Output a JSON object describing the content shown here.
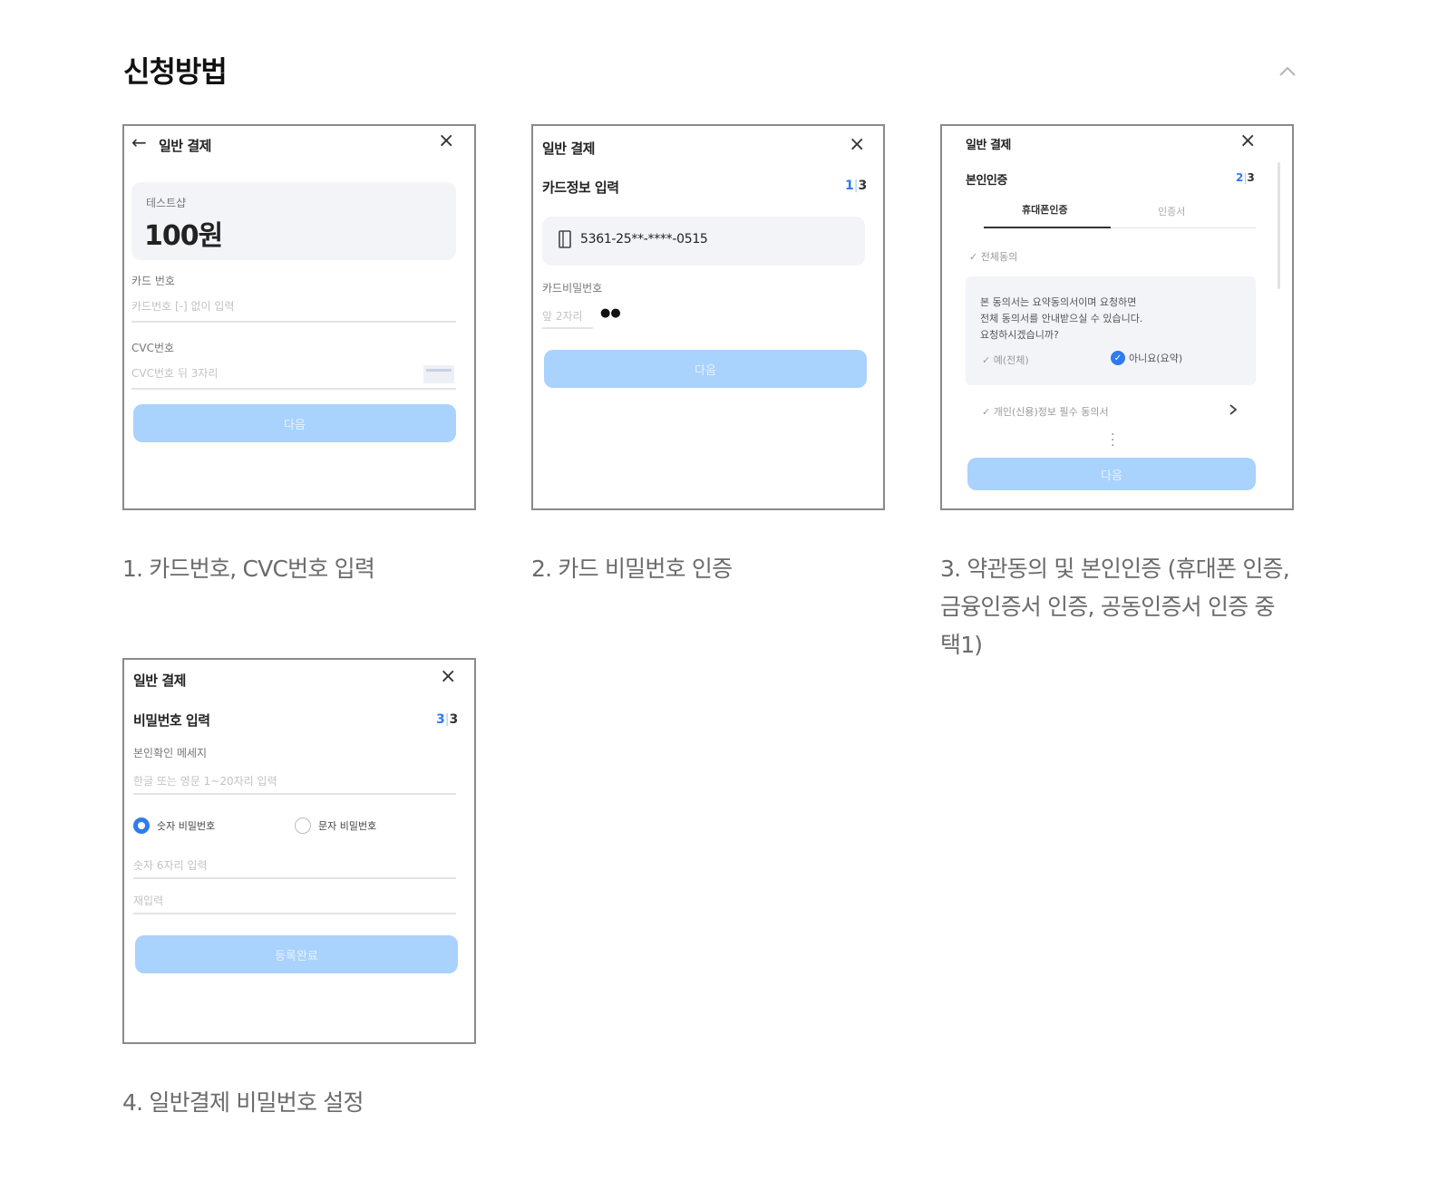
{
  "section": {
    "title": "신청방법",
    "collapse_icon": "chevron-up-icon"
  },
  "steps": [
    {
      "caption": "1. 카드번호, CVC번호 입력",
      "screen": {
        "back_icon": "←",
        "title": "일반 결제",
        "close_icon": "×",
        "shop_name": "테스트샵",
        "amount": "100원",
        "card_label": "카드 번호",
        "card_placeholder": "카드번호 [-] 없이 입력",
        "cvc_label": "CVC번호",
        "cvc_placeholder": "CVC번호 뒤 3자리",
        "next_button": "다음"
      }
    },
    {
      "caption": "2. 카드 비밀번호 인증",
      "screen": {
        "title": "일반 결제",
        "close_icon": "×",
        "subtitle": "카드정보 입력",
        "page_current": "1",
        "page_sep": "|",
        "page_total": "3",
        "card_number": "5361-25**-****-0515",
        "pw_label": "카드비밀번호",
        "pw_placeholder": "앞 2자리",
        "pw_dots": "●●",
        "next_button": "다음"
      }
    },
    {
      "caption": "3. 약관동의 및 본인인증 (휴대폰 인증, 금융인증서 인증, 공동인증서 인증 중 택1)",
      "screen": {
        "title": "일반 결제",
        "close_icon": "×",
        "subtitle": "본인인증",
        "page_current": "2",
        "page_sep": "|",
        "page_total": "3",
        "tab_phone": "휴대폰인증",
        "tab_cert": "인증서",
        "agree_all": "전체동의",
        "notice_line1": "본 동의서는 요약동의서이며 요청하면",
        "notice_line2": "전체 동의서를 안내받으실 수 있습니다.",
        "notice_line3": "요청하시겠습니까?",
        "opt_yes": "예(전체)",
        "opt_no": "아니요(요약)",
        "consent_item": "개인(신용)정보 필수 동의서",
        "next_button": "다음"
      }
    },
    {
      "caption": "4. 일반결제 비밀번호 설정",
      "screen": {
        "title": "일반 결제",
        "close_icon": "×",
        "subtitle": "비밀번호 입력",
        "page_current": "3",
        "page_sep": "|",
        "page_total": "3",
        "msg_label": "본인확인 메세지",
        "msg_placeholder": "한글 또는 영문 1~20자리 입력",
        "radio_num": "숫자 비밀번호",
        "radio_char": "문자 비밀번호",
        "pw_placeholder": "숫자 6자리 입력",
        "re_placeholder": "재입력",
        "done_button": "등록완료"
      }
    }
  ]
}
